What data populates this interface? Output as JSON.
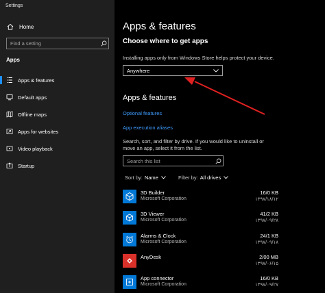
{
  "window": {
    "title": "Settings"
  },
  "sidebar": {
    "home_label": "Home",
    "search_placeholder": "Find a setting",
    "section_title": "Apps",
    "items": [
      {
        "label": "Apps & features",
        "icon": "list-icon",
        "active": true
      },
      {
        "label": "Default apps",
        "icon": "default-apps-icon"
      },
      {
        "label": "Offline maps",
        "icon": "map-icon"
      },
      {
        "label": "Apps for websites",
        "icon": "web-link-icon"
      },
      {
        "label": "Video playback",
        "icon": "video-icon"
      },
      {
        "label": "Startup",
        "icon": "startup-icon"
      }
    ]
  },
  "main": {
    "page_title": "Apps & features",
    "choose_heading": "Choose where to get apps",
    "choose_description": "Installing apps only from Windows Store helps protect your device.",
    "source_select_value": "Anywhere",
    "apps_heading": "Apps & features",
    "optional_features_link": "Optional features",
    "execution_aliases_link": "App execution aliases",
    "search_description": "Search, sort, and filter by drive. If you would like to uninstall or move an app, select it from the list.",
    "list_search_placeholder": "Search this list",
    "sort_label": "Sort by:",
    "sort_value": "Name",
    "filter_label": "Filter by:",
    "filter_value": "All drives",
    "apps": [
      {
        "name": "3D Builder",
        "publisher": "Microsoft Corporation",
        "size": "16/0 KB",
        "date": "۱۳۹۷/۱۸/۱۲",
        "icon": "3d-builder-icon",
        "icon_bg": "#0078d7"
      },
      {
        "name": "3D Viewer",
        "publisher": "Microsoft Corporation",
        "size": "41/2 KB",
        "date": "۱۳۹۷/۰۹/۲۸",
        "icon": "3d-viewer-icon",
        "icon_bg": "#0078d7"
      },
      {
        "name": "Alarms & Clock",
        "publisher": "Microsoft Corporation",
        "size": "24/1 KB",
        "date": "۱۳۹۷/۰۹/۱۸",
        "icon": "alarm-clock-icon",
        "icon_bg": "#0078d7"
      },
      {
        "name": "AnyDesk",
        "publisher": "",
        "size": "2/00 MB",
        "date": "۱۳۹۷/۰۶/۱۵",
        "icon": "anydesk-icon",
        "icon_bg": "#d9312a"
      },
      {
        "name": "App connector",
        "publisher": "Microsoft Corporation",
        "size": "16/0 KB",
        "date": "۱۳۹۷/۰۹/۲۷",
        "icon": "app-connector-icon",
        "icon_bg": "#0078d7"
      }
    ]
  },
  "colors": {
    "accent": "#1e90ff",
    "link": "#3f9bff",
    "annotation_arrow": "#e02020",
    "sidebar_bg": "#1f1f1f",
    "main_bg": "#000000"
  }
}
